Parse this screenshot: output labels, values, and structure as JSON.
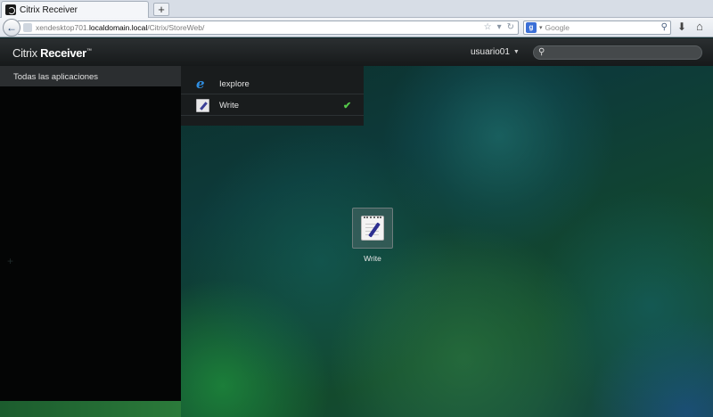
{
  "browser": {
    "tab_title": "Citrix Receiver",
    "new_tab_label": "+",
    "url_prefix": "xendesktop701.",
    "url_domain": "localdomain.local",
    "url_path": "/Citrix/StoreWeb/",
    "search_engine_label": "g",
    "search_placeholder": "Google"
  },
  "receiver": {
    "logo_light": "Citrix",
    "logo_bold": "Receiver",
    "logo_tm": "™",
    "username": "usuario01",
    "search_placeholder": "",
    "sidebar_items": [
      {
        "label": "Todas las aplicaciones"
      }
    ],
    "menu_items": [
      {
        "label": "Iexplore",
        "icon": "internet-explorer-icon",
        "selected": false
      },
      {
        "label": "Write",
        "icon": "wordpad-write-icon",
        "selected": true
      }
    ],
    "tiles": [
      {
        "label": "Write",
        "icon": "wordpad-write-icon"
      }
    ]
  },
  "colors": {
    "selected_check": "#55c94a",
    "header_bg": "#1f2324",
    "sidebar_bg": "#040505"
  }
}
